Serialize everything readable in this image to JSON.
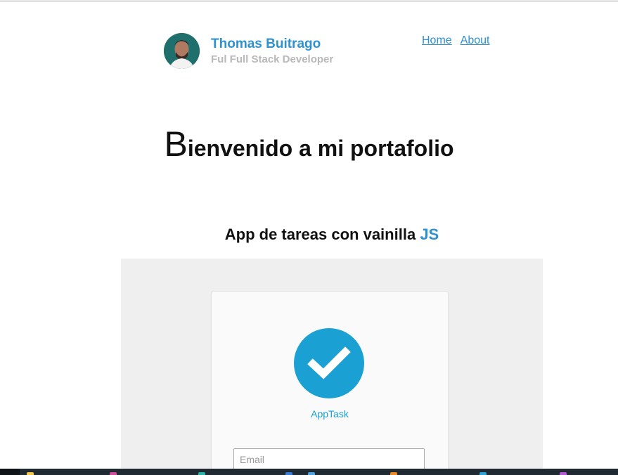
{
  "header": {
    "name": "Thomas Buitrago",
    "role": "Ful Full Stack Developer",
    "nav": [
      {
        "label": "Home"
      },
      {
        "label": "About"
      }
    ]
  },
  "hero": {
    "drop_cap": "B",
    "rest": "ienvenido a mi portafolio"
  },
  "project": {
    "title": "App de tareas con vainilla",
    "title_accent": "JS",
    "preview": {
      "app_name": "AppTask",
      "email_placeholder": "Email",
      "icon": "check-circle-icon"
    }
  },
  "colors": {
    "accent": "#2f91cf",
    "app_blue": "#1aa0d3",
    "muted": "#b8b8b8"
  }
}
